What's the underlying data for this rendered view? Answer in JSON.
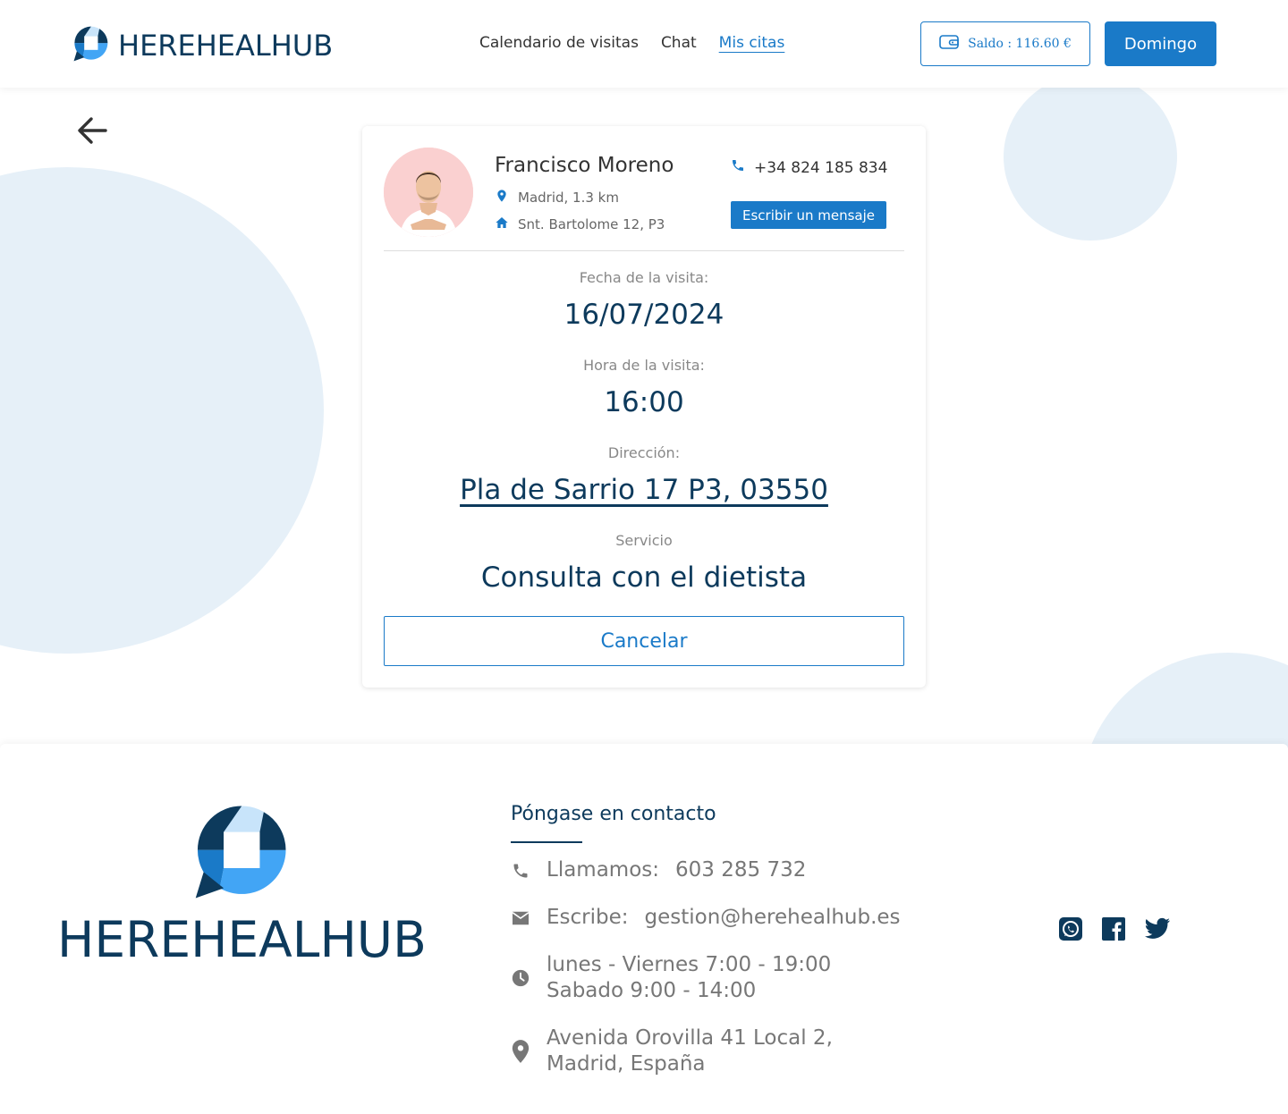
{
  "header": {
    "logo_text": "HEREHEALHUB",
    "nav": [
      {
        "label": "Calendario de visitas",
        "active": false
      },
      {
        "label": "Chat",
        "active": false
      },
      {
        "label": "Mis citas",
        "active": true
      }
    ],
    "wallet_label": "Saldo : 116.60 €",
    "user_button": "Domingo"
  },
  "doctor": {
    "name": "Francisco Moreno",
    "location": "Madrid, 1.3 km",
    "address": "Snt. Bartolome 12, P3",
    "phone": "+34 824 185 834",
    "message_button": "Escribir un mensaje"
  },
  "visit": {
    "date_label": "Fecha de la visita:",
    "date": "16/07/2024",
    "time_label": "Hora de la visita:",
    "time": "16:00",
    "address_label": "Dirección:",
    "address": "Pla de Sarrio 17 P3, 03550",
    "service_label": "Servicio",
    "service": "Consulta con el dietista",
    "cancel_button": "Cancelar"
  },
  "footer": {
    "logo_text": "HEREHEALHUB",
    "contact_title": "Póngase en contacto",
    "call_label": "Llamamos:",
    "call_value": "603 285 732",
    "write_label": "Escribe:",
    "write_value": "gestion@herehealhub.es",
    "hours_line1": "lunes - Viernes 7:00 - 19:00",
    "hours_line2": "Sabado 9:00 - 14:00",
    "address_line1": "Avenida Orovilla 41 Local 2,",
    "address_line2": "Madrid, España"
  },
  "colors": {
    "brand_dark": "#0d3a5c",
    "accent": "#1a7ac8",
    "background_circle": "#e6f0f8"
  },
  "icons": [
    "logo-icon",
    "wallet-icon",
    "back-arrow-icon",
    "location-pin-icon",
    "home-icon",
    "phone-icon",
    "mail-icon",
    "clock-icon",
    "whatsapp-icon",
    "facebook-icon",
    "twitter-icon"
  ]
}
